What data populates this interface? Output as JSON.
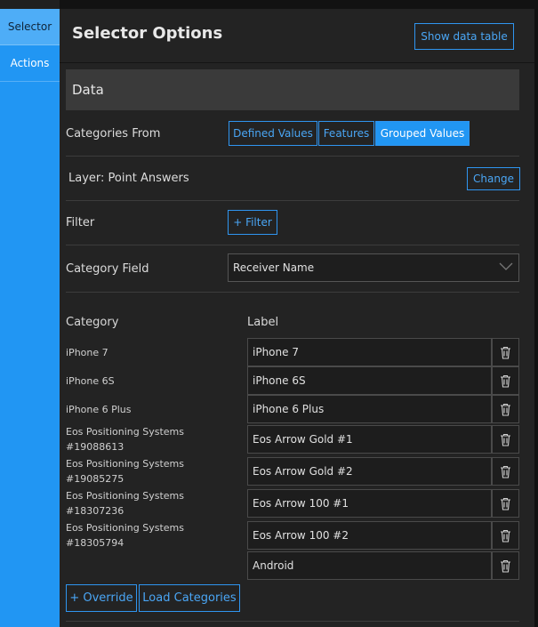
{
  "sidebar": {
    "tabs": [
      {
        "label": "Selector"
      },
      {
        "label": "Actions"
      }
    ]
  },
  "header": {
    "title": "Selector Options",
    "show_table_label": "Show data table"
  },
  "data_section": {
    "title": "Data"
  },
  "categories_from": {
    "label": "Categories From",
    "options": [
      "Defined Values",
      "Features",
      "Grouped Values"
    ],
    "selected": "Grouped Values"
  },
  "layer": {
    "label": "Layer: Point Answers",
    "change_label": "Change"
  },
  "filter": {
    "label": "Filter",
    "button_label": "+ Filter"
  },
  "category_field": {
    "label": "Category Field",
    "value": "Receiver Name"
  },
  "mapping": {
    "category_header": "Category",
    "label_header": "Label",
    "categories": [
      "iPhone 7",
      "iPhone 6S",
      "iPhone 6 Plus",
      "Eos Positioning Systems #19088613",
      "Eos Positioning Systems #19085275",
      "Eos Positioning Systems #18307236",
      "Eos Positioning Systems #18305794"
    ],
    "labels": [
      "iPhone 7",
      "iPhone 6S",
      "iPhone 6 Plus",
      "Eos Arrow Gold #1",
      "Eos Arrow Gold #2",
      "Eos Arrow 100 #1",
      "Eos Arrow 100 #2",
      "Android"
    ]
  },
  "footer": {
    "override_label": "+ Override",
    "load_label": "Load Categories"
  },
  "icons": {
    "trash": "trash-icon",
    "dropdown": "chevron-down-icon"
  },
  "colors": {
    "accent": "#2196f3",
    "background": "#232323",
    "section": "#3a3a3a"
  }
}
